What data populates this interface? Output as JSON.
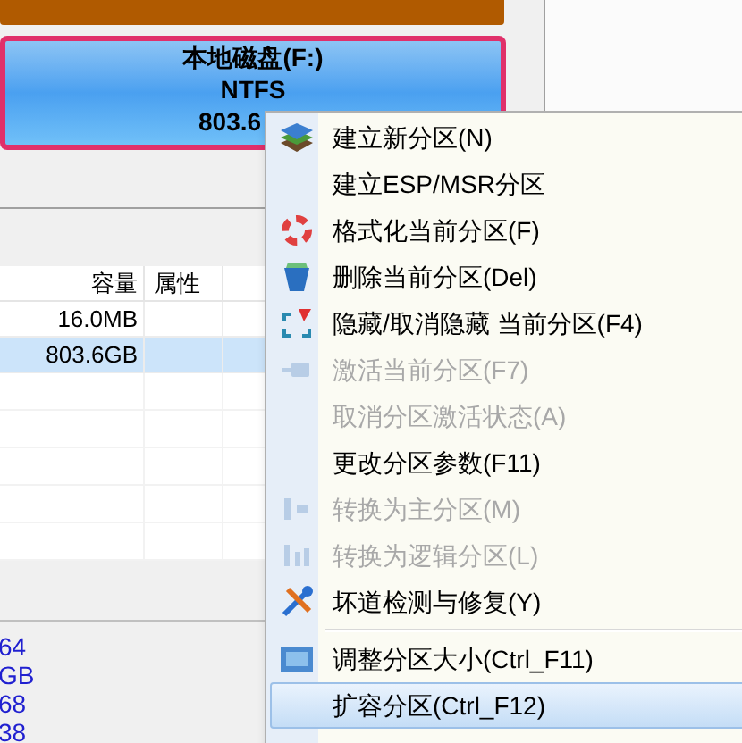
{
  "partition": {
    "name": "本地磁盘(F:)",
    "filesystem": "NTFS",
    "size": "803.6"
  },
  "table": {
    "columns": [
      "容量",
      "属性"
    ],
    "rows": [
      {
        "cells": [
          "16.0MB",
          ""
        ],
        "selected": false
      },
      {
        "cells": [
          "803.6GB",
          ""
        ],
        "selected": true
      }
    ]
  },
  "side_values": [
    "64",
    "GB",
    "68",
    "38"
  ],
  "context_menu": [
    {
      "kind": "item",
      "label": "建立新分区(N)",
      "disabled": false,
      "selected": false
    },
    {
      "kind": "item",
      "label": "建立ESP/MSR分区",
      "disabled": false,
      "selected": false
    },
    {
      "kind": "item",
      "label": "格式化当前分区(F)",
      "disabled": false,
      "selected": false
    },
    {
      "kind": "item",
      "label": "删除当前分区(Del)",
      "disabled": false,
      "selected": false
    },
    {
      "kind": "item",
      "label": "隐藏/取消隐藏 当前分区(F4)",
      "disabled": false,
      "selected": false
    },
    {
      "kind": "item",
      "label": "激活当前分区(F7)",
      "disabled": true,
      "selected": false
    },
    {
      "kind": "item",
      "label": "取消分区激活状态(A)",
      "disabled": true,
      "selected": false
    },
    {
      "kind": "item",
      "label": "更改分区参数(F11)",
      "disabled": false,
      "selected": false
    },
    {
      "kind": "item",
      "label": "转换为主分区(M)",
      "disabled": true,
      "selected": false
    },
    {
      "kind": "item",
      "label": "转换为逻辑分区(L)",
      "disabled": true,
      "selected": false
    },
    {
      "kind": "item",
      "label": "坏道检测与修复(Y)",
      "disabled": false,
      "selected": false
    },
    {
      "kind": "separator"
    },
    {
      "kind": "item",
      "label": "调整分区大小(Ctrl_F11)",
      "disabled": false,
      "selected": false
    },
    {
      "kind": "item",
      "label": "扩容分区(Ctrl_F12)",
      "disabled": false,
      "selected": true
    }
  ]
}
